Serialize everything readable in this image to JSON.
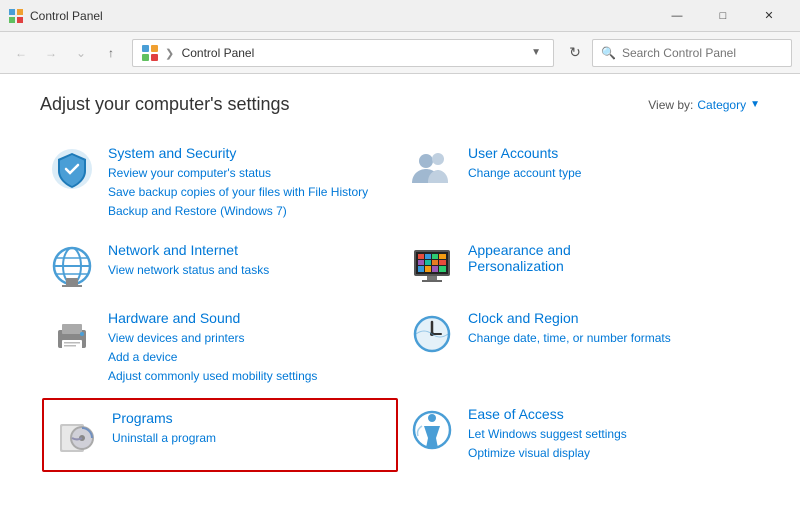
{
  "titleBar": {
    "icon": "control-panel",
    "title": "Control Panel",
    "minimize": "—",
    "maximize": "□",
    "close": "✕"
  },
  "navBar": {
    "back": "←",
    "forward": "→",
    "up": "↑",
    "addressIcon": "control-panel",
    "addressPath": "Control Panel",
    "dropdownArrow": "▾",
    "refreshIcon": "↻",
    "searchPlaceholder": "Search Control Panel"
  },
  "main": {
    "title": "Adjust your computer's settings",
    "viewByLabel": "View by:",
    "viewByValue": "Category",
    "categories": [
      {
        "id": "system-security",
        "title": "System and Security",
        "links": [
          "Review your computer's status",
          "Save backup copies of your files with File History",
          "Backup and Restore (Windows 7)"
        ],
        "highlighted": false
      },
      {
        "id": "user-accounts",
        "title": "User Accounts",
        "links": [
          "Change account type"
        ],
        "highlighted": false
      },
      {
        "id": "network-internet",
        "title": "Network and Internet",
        "links": [
          "View network status and tasks"
        ],
        "highlighted": false
      },
      {
        "id": "appearance-personalization",
        "title": "Appearance and Personalization",
        "links": [],
        "highlighted": false
      },
      {
        "id": "hardware-sound",
        "title": "Hardware and Sound",
        "links": [
          "View devices and printers",
          "Add a device",
          "Adjust commonly used mobility settings"
        ],
        "highlighted": false
      },
      {
        "id": "clock-region",
        "title": "Clock and Region",
        "links": [
          "Change date, time, or number formats"
        ],
        "highlighted": false
      },
      {
        "id": "programs",
        "title": "Programs",
        "links": [
          "Uninstall a program"
        ],
        "highlighted": true
      },
      {
        "id": "ease-of-access",
        "title": "Ease of Access",
        "links": [
          "Let Windows suggest settings",
          "Optimize visual display"
        ],
        "highlighted": false
      }
    ]
  }
}
